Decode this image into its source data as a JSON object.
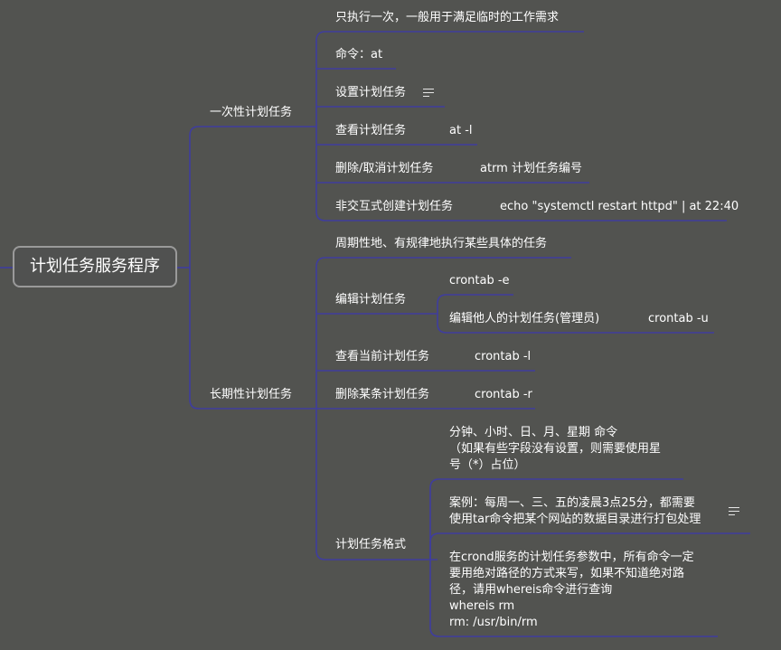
{
  "mindmap": {
    "root": "计划任务服务程序",
    "once": {
      "label": "一次性计划任务",
      "desc": "只执行一次，一般用于满足临时的工作需求",
      "cmd": "命令：at",
      "set": "设置计划任务",
      "view": "查看计划任务",
      "view_cmd": "at -l",
      "del": "删除/取消计划任务",
      "del_cmd": "atrm 计划任务编号",
      "nonint": "非交互式创建计划任务",
      "nonint_cmd": "echo \"systemctl restart httpd\" | at 22:40"
    },
    "periodic": {
      "label": "长期性计划任务",
      "desc": "周期性地、有规律地执行某些具体的任务",
      "edit": "编辑计划任务",
      "edit_cmd": "crontab -e",
      "edit_other": "编辑他人的计划任务(管理员)",
      "edit_other_cmd": "crontab -u",
      "view": "查看当前计划任务",
      "view_cmd": "crontab -l",
      "del": "删除某条计划任务",
      "del_cmd": "crontab -r",
      "format": "计划任务格式",
      "format_fields": [
        "分钟、小时、日、月、星期 命令",
        "（如果有些字段没有设置，则需要使用星",
        "号（*）占位）"
      ],
      "format_example": [
        "案例：每周一、三、五的凌晨3点25分，都需要",
        "使用tar命令把某个网站的数据目录进行打包处理"
      ],
      "format_path": [
        "在crond服务的计划任务参数中，所有命令一定",
        "要用绝对路径的方式来写，如果不知道绝对路",
        "径，请用whereis命令进行查询",
        "whereis rm",
        "rm: /usr/bin/rm"
      ]
    }
  },
  "icons": [
    "note-icon",
    "note-icon"
  ],
  "colors": {
    "background": "#525350",
    "edge": "#3f3d9e",
    "text": "#ffffff",
    "root_border": "#9a9a9a"
  }
}
